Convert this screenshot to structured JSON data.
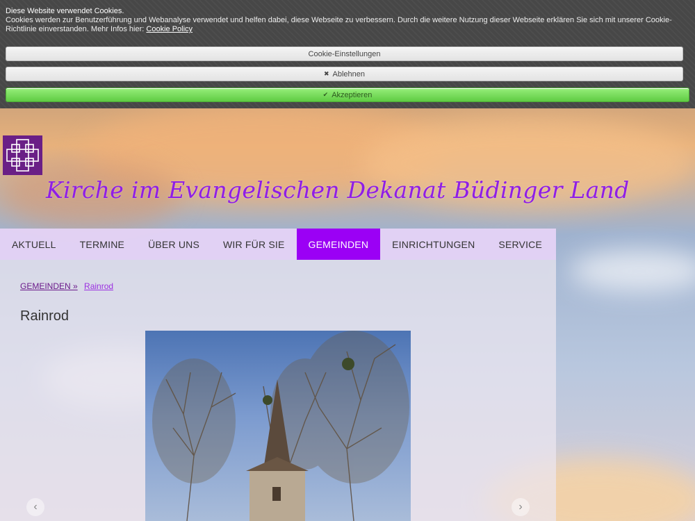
{
  "cookie_banner": {
    "title": "Diese Website verwendet Cookies.",
    "text": "Cookies werden zur Benutzerführung und Webanalyse verwendet und helfen dabei, diese Webseite zu verbessern. Durch die weitere Nutzung dieser Webseite erklären Sie sich mit unserer Cookie-Richtlinie einverstanden. Mehr Infos hier:",
    "policy_link": "Cookie Policy",
    "settings_label": "Cookie-Einstellungen",
    "decline_label": "Ablehnen",
    "accept_label": "Akzeptieren",
    "decline_icon": "✖",
    "accept_icon": "✔"
  },
  "header": {
    "site_title": "Kirche im Evangelischen Dekanat Büdinger Land",
    "logo": "cross-logo",
    "logo_color": "#6a1f86",
    "title_color": "#8f1ee6"
  },
  "nav": {
    "items": [
      "AKTUELL",
      "TERMINE",
      "ÜBER UNS",
      "WIR FÜR SIE",
      "GEMEINDEN",
      "EINRICHTUNGEN",
      "SERVICE"
    ],
    "active": "GEMEINDEN",
    "active_color": "#9b00f5"
  },
  "breadcrumb": {
    "parent": "GEMEINDEN »",
    "current": "Rainrod"
  },
  "page": {
    "heading": "Rainrod",
    "slider_prev_icon": "‹",
    "slider_next_icon": "›"
  }
}
